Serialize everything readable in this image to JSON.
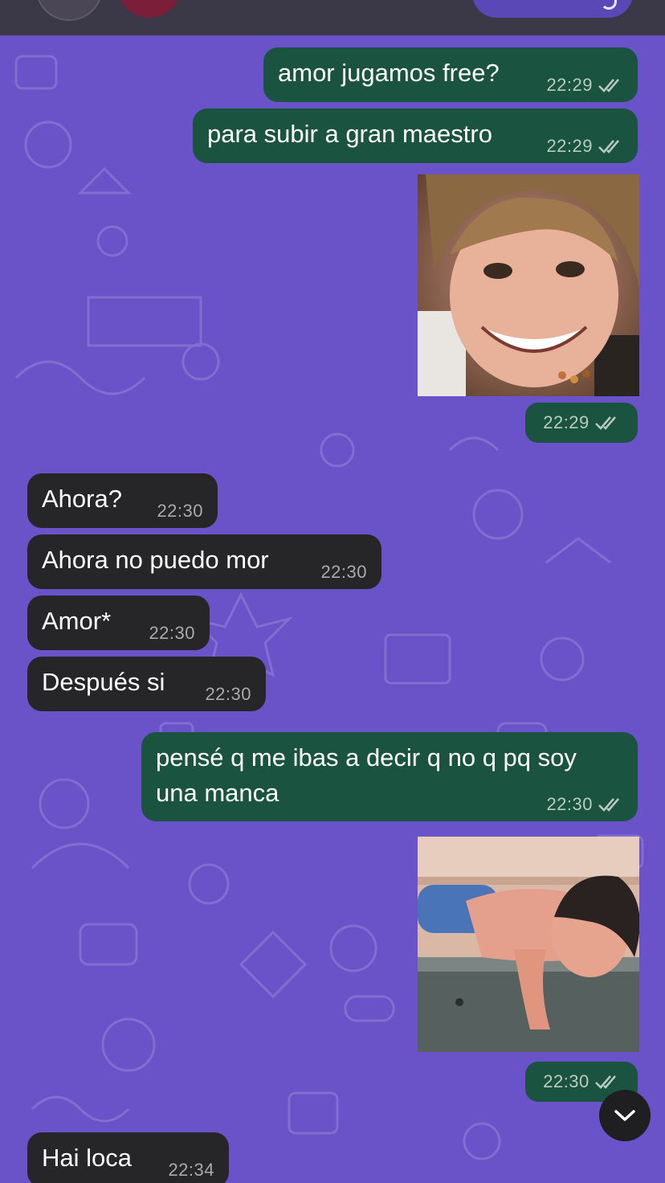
{
  "theme": {
    "wallpaper": "#6a52c8",
    "outgoing_bubble": "#1a5440",
    "incoming_bubble": "#262628",
    "read_ticks": "#b8cbc2"
  },
  "messages": [
    {
      "direction": "out",
      "text": "amor jugamos free?",
      "time": "22:29",
      "status": "double-check-icon"
    },
    {
      "direction": "out",
      "text": "para subir a gran maestro",
      "time": "22:29",
      "status": "double-check-icon"
    },
    {
      "direction": "out",
      "type": "image",
      "image_icon": "smiling-child-photo",
      "time": "22:29",
      "status": "double-check-icon"
    },
    {
      "direction": "in",
      "text": "Ahora?",
      "time": "22:30"
    },
    {
      "direction": "in",
      "text": "Ahora no puedo mor",
      "time": "22:30"
    },
    {
      "direction": "in",
      "text": "Amor*",
      "time": "22:30"
    },
    {
      "direction": "in",
      "text": "Después si",
      "time": "22:30"
    },
    {
      "direction": "out",
      "text_line1": "pensé q me ibas a decir q no q pq soy",
      "text_line2": "una manca",
      "time": "22:30",
      "status": "double-check-icon"
    },
    {
      "direction": "out",
      "type": "image",
      "image_icon": "child-on-ledge-photo",
      "time": "22:30",
      "status": "double-check-icon"
    },
    {
      "direction": "in",
      "text": "Hai loca",
      "time": "22:34"
    }
  ],
  "controls": {
    "scroll_down_icon": "chevron-down-icon"
  }
}
